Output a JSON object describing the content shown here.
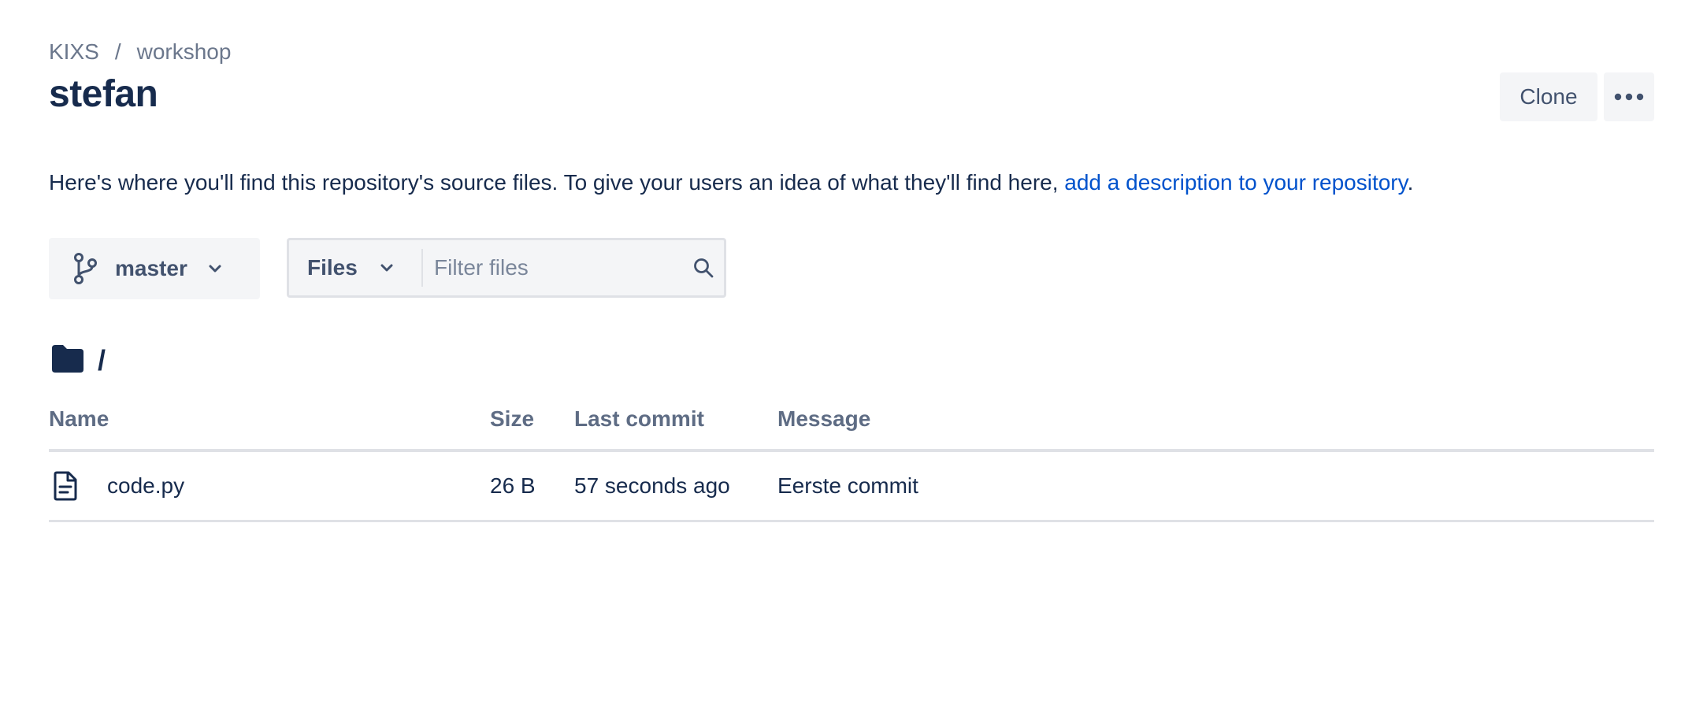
{
  "breadcrumb": {
    "project": "KIXS",
    "separator": "/",
    "repo": "workshop"
  },
  "title": "stefan",
  "actions": {
    "clone_label": "Clone",
    "more_icon": "more-horizontal-icon"
  },
  "description": {
    "text": "Here's where you'll find this repository's source files. To give your users an idea of what they'll find here, ",
    "link": "add a description to your repository",
    "suffix": "."
  },
  "branch": {
    "icon": "branch-icon",
    "name": "master"
  },
  "filter": {
    "mode": "Files",
    "placeholder": "Filter files"
  },
  "path": {
    "icon": "folder-icon",
    "value": "/"
  },
  "table": {
    "headers": {
      "name": "Name",
      "size": "Size",
      "last_commit": "Last commit",
      "message": "Message"
    },
    "rows": [
      {
        "icon": "file-icon",
        "name": "code.py",
        "size": "26 B",
        "last_commit": "57 seconds ago",
        "message": "Eerste commit"
      }
    ]
  },
  "colors": {
    "text": "#172b4d",
    "subtle": "#6b778c",
    "link": "#0052cc",
    "button_bg": "#f4f5f7",
    "border": "#dfe1e6"
  }
}
